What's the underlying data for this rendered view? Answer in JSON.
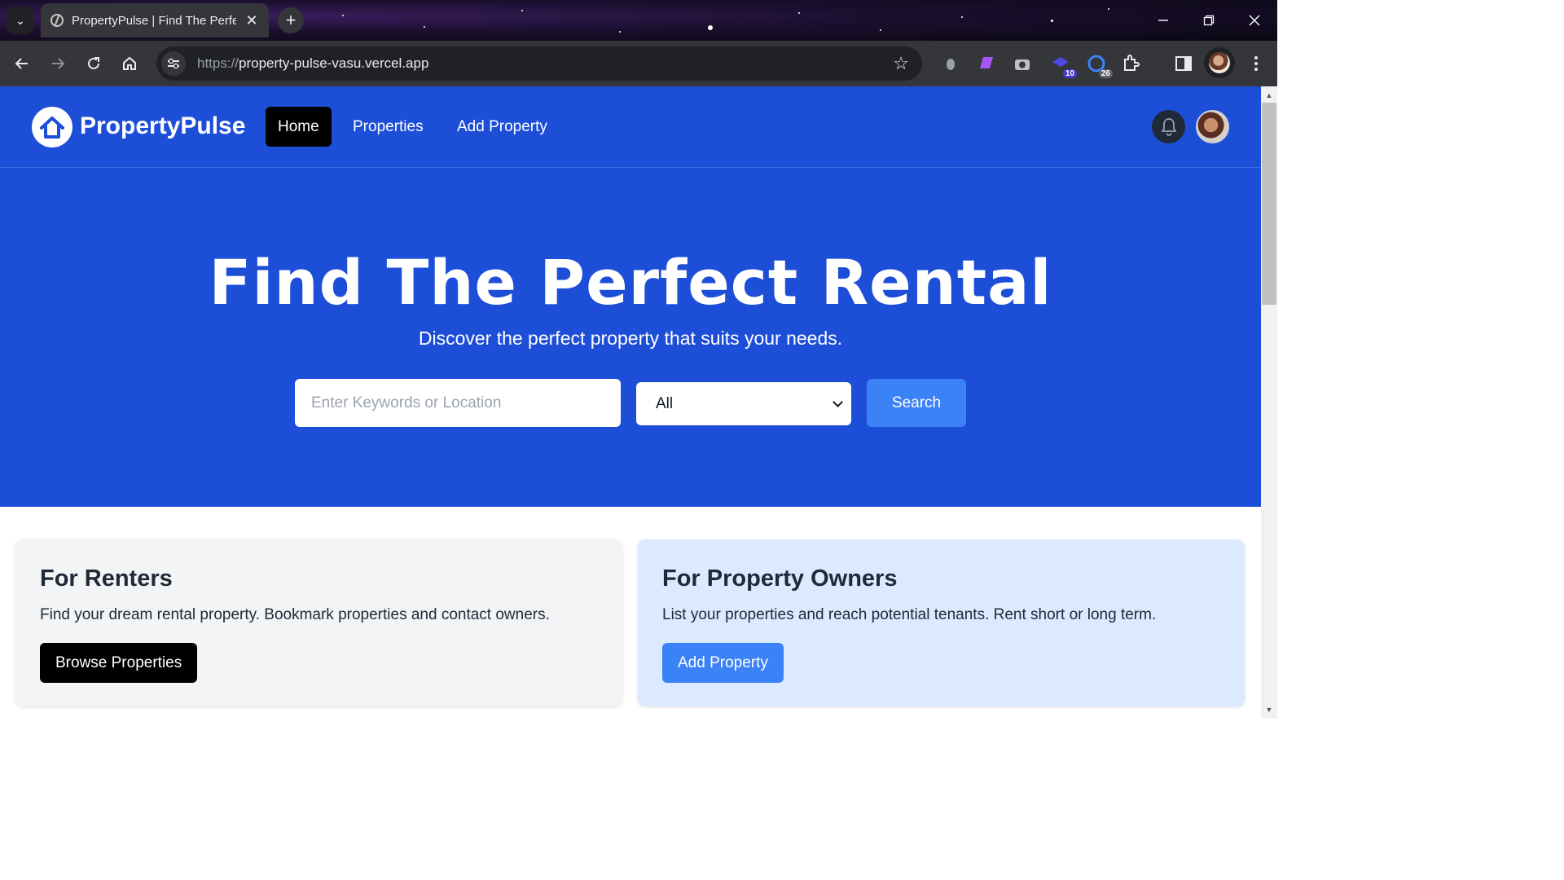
{
  "browser": {
    "tab_title": "PropertyPulse | Find The Perfect Rental",
    "tab_close": "✕",
    "new_tab": "+",
    "url_scheme": "https://",
    "url_host": "property-pulse-vasu.vercel.app",
    "extensions": [
      {
        "name": "extension-1-icon"
      },
      {
        "name": "extension-2-icon"
      },
      {
        "name": "extension-3-icon"
      },
      {
        "name": "extension-4-icon",
        "badge": "10"
      },
      {
        "name": "extension-5-icon",
        "badge": "26"
      },
      {
        "name": "extensions-puzzle-icon"
      }
    ]
  },
  "nav": {
    "brand": "PropertyPulse",
    "links": [
      {
        "label": "Home",
        "active": true
      },
      {
        "label": "Properties",
        "active": false
      },
      {
        "label": "Add Property",
        "active": false
      }
    ]
  },
  "hero": {
    "title": "Find The Perfect Rental",
    "subtitle": "Discover the perfect property that suits your needs.",
    "search_placeholder": "Enter Keywords or Location",
    "type_selected": "All",
    "search_button": "Search"
  },
  "cards": {
    "renters": {
      "title": "For Renters",
      "text": "Find your dream rental property. Bookmark properties and contact owners.",
      "button": "Browse Properties"
    },
    "owners": {
      "title": "For Property Owners",
      "text": "List your properties and reach potential tenants. Rent short or long term.",
      "button": "Add Property"
    }
  },
  "colors": {
    "primary_blue": "#1d4ed8",
    "button_blue": "#3b82f6",
    "owners_card_bg": "#dbeafe",
    "renters_card_bg": "#f3f4f6"
  }
}
